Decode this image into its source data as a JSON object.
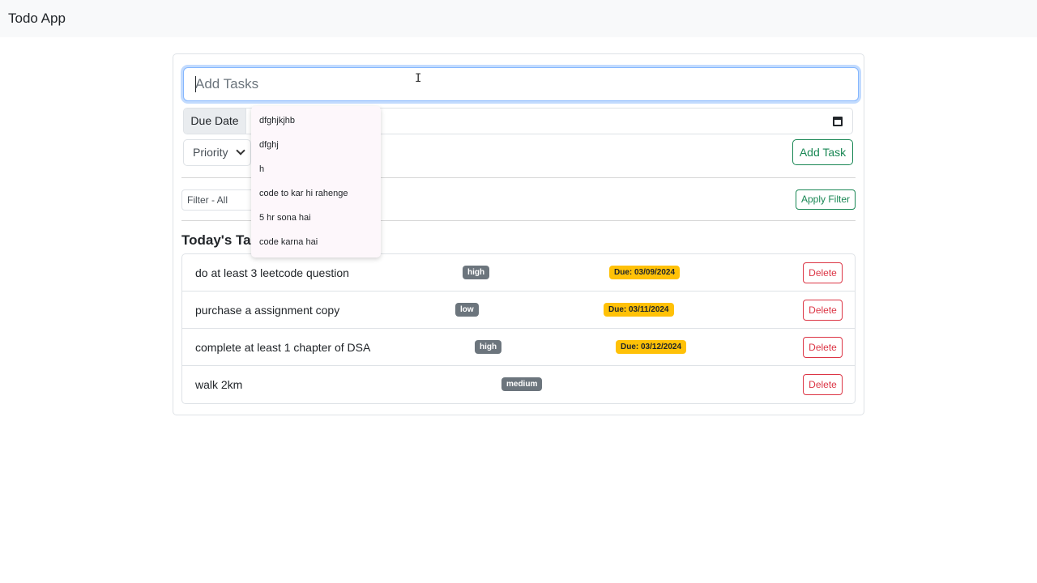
{
  "navbar": {
    "brand": "Todo App"
  },
  "form": {
    "task_placeholder": "Add Tasks",
    "due_label": "Due Date",
    "priority_label": "Priority",
    "add_label": "Add Task"
  },
  "filter": {
    "selected": "Filter - All",
    "apply_label": "Apply Filter"
  },
  "heading": "Today's Tasks",
  "autocomplete": [
    "dfghjkjhb",
    "dfghj",
    "h",
    "code to kar hi rahenge",
    "5 hr sona hai",
    "code karna hai"
  ],
  "tasks": [
    {
      "text": "do at least 3 leetcode question",
      "priority": "high",
      "due": "Due: 03/09/2024",
      "delete": "Delete"
    },
    {
      "text": "purchase a assignment copy",
      "priority": "low",
      "due": "Due: 03/11/2024",
      "delete": "Delete"
    },
    {
      "text": "complete at least 1 chapter of DSA",
      "priority": "high",
      "due": "Due: 03/12/2024",
      "delete": "Delete"
    },
    {
      "text": "walk 2km",
      "priority": "medium",
      "due": "",
      "delete": "Delete"
    }
  ],
  "colors": {
    "success": "#198754",
    "danger": "#dc3545",
    "warning": "#ffc107",
    "secondary": "#6c757d",
    "focus": "#86b7fe"
  }
}
